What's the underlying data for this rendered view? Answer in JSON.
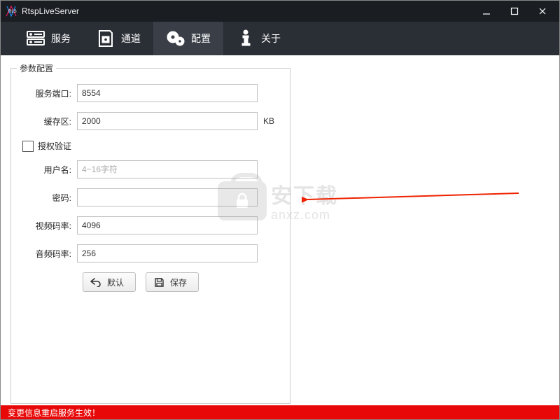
{
  "window": {
    "title": "RtspLiveServer"
  },
  "tabs": {
    "service": "服务",
    "channel": "通道",
    "config": "配置",
    "about": "关于"
  },
  "params": {
    "legend": "参数配置",
    "port_label": "服务端口:",
    "port_value": "8554",
    "buffer_label": "缓存区:",
    "buffer_value": "2000",
    "buffer_unit": "KB",
    "auth_label": "授权验证",
    "user_label": "用户名:",
    "user_placeholder": "4~16字符",
    "pwd_label": "密码:",
    "vbitrate_label": "视频码率:",
    "vbitrate_value": "4096",
    "abitrate_label": "音频码率:",
    "abitrate_value": "256",
    "btn_default": "默认",
    "btn_save": "保存"
  },
  "footer": {
    "notice": "变更信息重启服务生效！"
  },
  "watermark": {
    "line1": "安下载",
    "line2": "anxz.com"
  }
}
